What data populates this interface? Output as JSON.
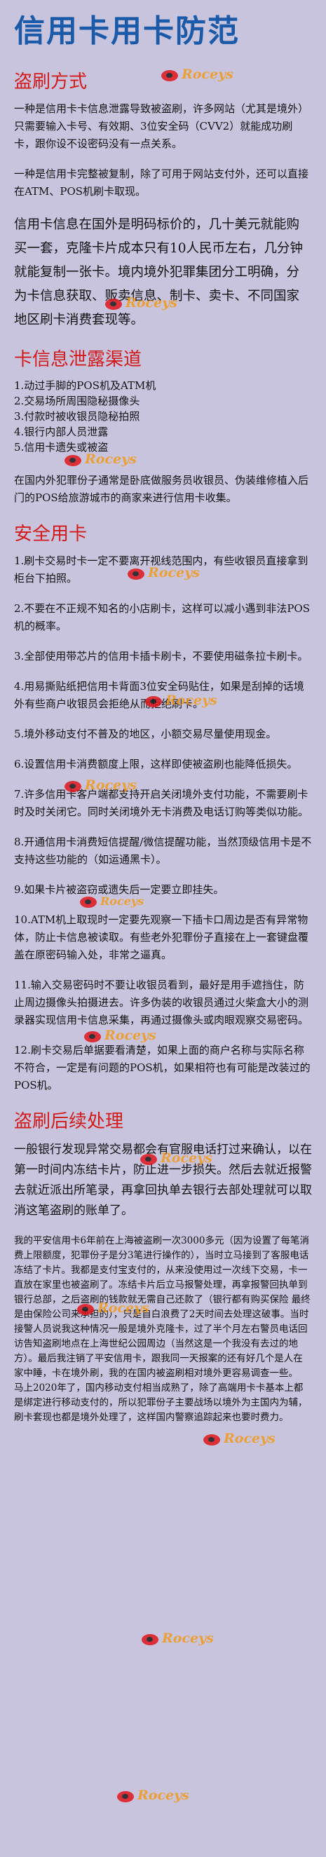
{
  "title": "信用卡用卡防范",
  "watermark": "Roceys",
  "section1": {
    "heading": "盗刷方式",
    "p1": "一种是信用卡卡信息泄露导致被盗刷，许多网站（尤其是境外）只需要输入卡号、有效期、3位安全码（CVV2）就能成功刷卡，跟你设不设密码没有一点关系。",
    "p2": "一种是信用卡完整被复制，除了可用于网站支付外，还可以直接在ATM、POS机刷卡取现。",
    "p3": "信用卡信息在国外是明码标价的，几十美元就能购买一套，克隆卡片成本只有10人民币左右，几分钟就能复制一张卡。境内境外犯罪集团分工明确，分为卡信息获取、贩卖信息、制卡、卖卡、不同国家地区刷卡消费套现等。"
  },
  "section2": {
    "heading": "卡信息泄露渠道",
    "items": [
      "1.动过手脚的POS机及ATM机",
      "2.交易场所周围隐秘摄像头",
      "3.付款时被收银员隐秘拍照",
      "4.银行内部人员泄露",
      "5.信用卡遗失或被盗"
    ],
    "p1": "在国内外犯罪份子通常是卧底做服务员收银员、伪装维修植入后门的POS给旅游城市的商家来进行信用卡收集。"
  },
  "section3": {
    "heading": "安全用卡",
    "items": [
      "1.刷卡交易时卡一定不要离开视线范围内，有些收银员直接拿到柜台下拍照。",
      "2.不要在不正规不知名的小店刷卡，这样可以减小遇到非法POS机的概率。",
      "3.全部使用带芯片的信用卡插卡刷卡，不要使用磁条拉卡刷卡。",
      "4.用易撕贴纸把信用卡背面3位安全码贴住，如果是刮掉的话境外有些商户收银员会拒绝从而拒绝刷卡。",
      "5.境外移动支付不普及的地区，小额交易尽量使用现金。",
      "6.设置信用卡消费额度上限，这样即使被盗刷也能降低损失。",
      "7.许多信用卡客户端都支持开启关闭境外支付功能，不需要刷卡时及时关闭它。同时关闭境外无卡消费及电话订购等类似功能。",
      "8.开通信用卡消费短信提醒/微信提醒功能，当然顶级信用卡是不支持这些功能的（如运通黑卡）。",
      "9.如果卡片被盗窃或遗失后一定要立即挂失。",
      "10.ATM机上取现时一定要先观察一下插卡口周边是否有异常物体，防止卡信息被读取。有些老外犯罪份子直接在上一套键盘覆盖在原密码输入处，非常之逼真。",
      "11.输入交易密码时不要让收银员看到，最好是用手遮挡住，防止周边摄像头拍摄进去。许多伪装的收银员通过火柴盒大小的测录器实现信用卡信息采集，再通过摄像头或肉眼观察交易密码。",
      "12.刷卡交易后单据要看清楚，如果上面的商户名称与实际名称不符合，一定是有问题的POS机，如果相符也有可能是改装过的POS机。"
    ]
  },
  "section4": {
    "heading": "盗刷后续处理",
    "p1": "一般银行发现异常交易都会有官服电话打过来确认，以在第一时间内冻结卡片，防止进一步损失。然后去就近报警去就近派出所笔录，再拿回执单去银行去部处理就可以取消这笔盗刷的账单了。",
    "p2": "我的平安信用卡6年前在上海被盗刷一次3000多元（因为设置了每笔消费上限额度，犯罪份子是分3笔进行操作的），当时立马接到了客服电话冻结了卡片。我都是支付宝支付的，从来没使用过一次线下交易，卡一直放在家里也被盗刷了。冻结卡片后立马报警处理，再拿报警回执单到银行总部，之后盗刷的钱款就无需自己还款了（银行都有购买保险 最终是由保险公司来承担的），只是自白浪费了2天时间去处理这破事。当时接警人员说我这种情况一般是境外克隆卡，过了半个月左右警员电话回访告知盗刷地点在上海世纪公园周边（当然这是一个我没有去过的地方）。最后我注销了平安信用卡，跟我同一天报案的还有好几个是人在家中睡，卡在境外刷，我的在国内被盗刷相对境外更容易调查一些。",
    "p3": "马上2020年了，国内移动支付相当成熟了，除了高端用卡卡基本上都是绑定进行移动支付的，所以犯罪份子主要战场以境外为主国内为辅，刷卡套现也都是境外处理了，这样国内警察追踪起来也要时费力。"
  }
}
